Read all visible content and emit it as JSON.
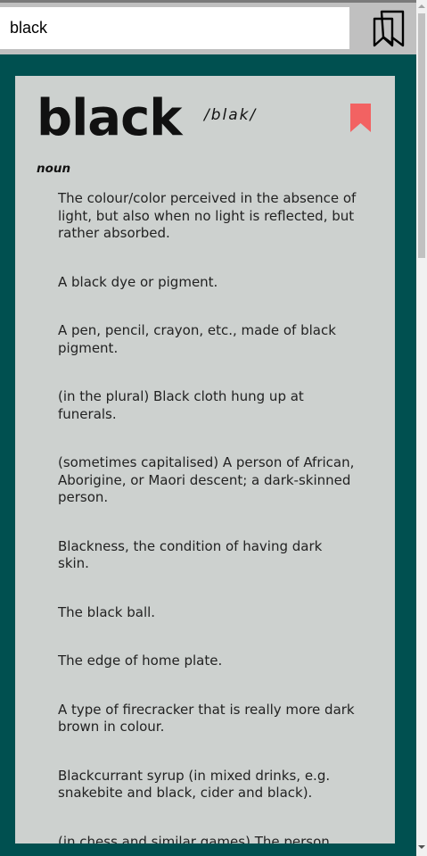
{
  "search": {
    "value": "black"
  },
  "entry": {
    "word": "black",
    "phonetic": "/blak/",
    "part_of_speech": "noun",
    "definitions": [
      "The colour/color perceived in the absence of light, but also when no light is reflected, but rather absorbed.",
      "A black dye or pigment.",
      "A pen, pencil, crayon, etc., made of black pigment.",
      "(in the plural) Black cloth hung up at funerals.",
      "(sometimes capitalised) A person of African, Aborigine, or Maori descent; a dark-skinned person.",
      "Blackness, the condition of having dark skin.",
      "The black ball.",
      "The edge of home plate.",
      "A type of firecracker that is really more dark brown in colour.",
      "Blackcurrant syrup (in mixed drinks, e.g. snakebite and black, cider and black).",
      "(in chess and similar games) The person"
    ]
  },
  "icons": {
    "bookmarks": "bookmarks-icon",
    "save": "bookmark-icon"
  },
  "colors": {
    "background": "#005050",
    "card": "#cdd1cf",
    "header": "#c0c0c0",
    "bookmark_accent": "#f26262"
  }
}
